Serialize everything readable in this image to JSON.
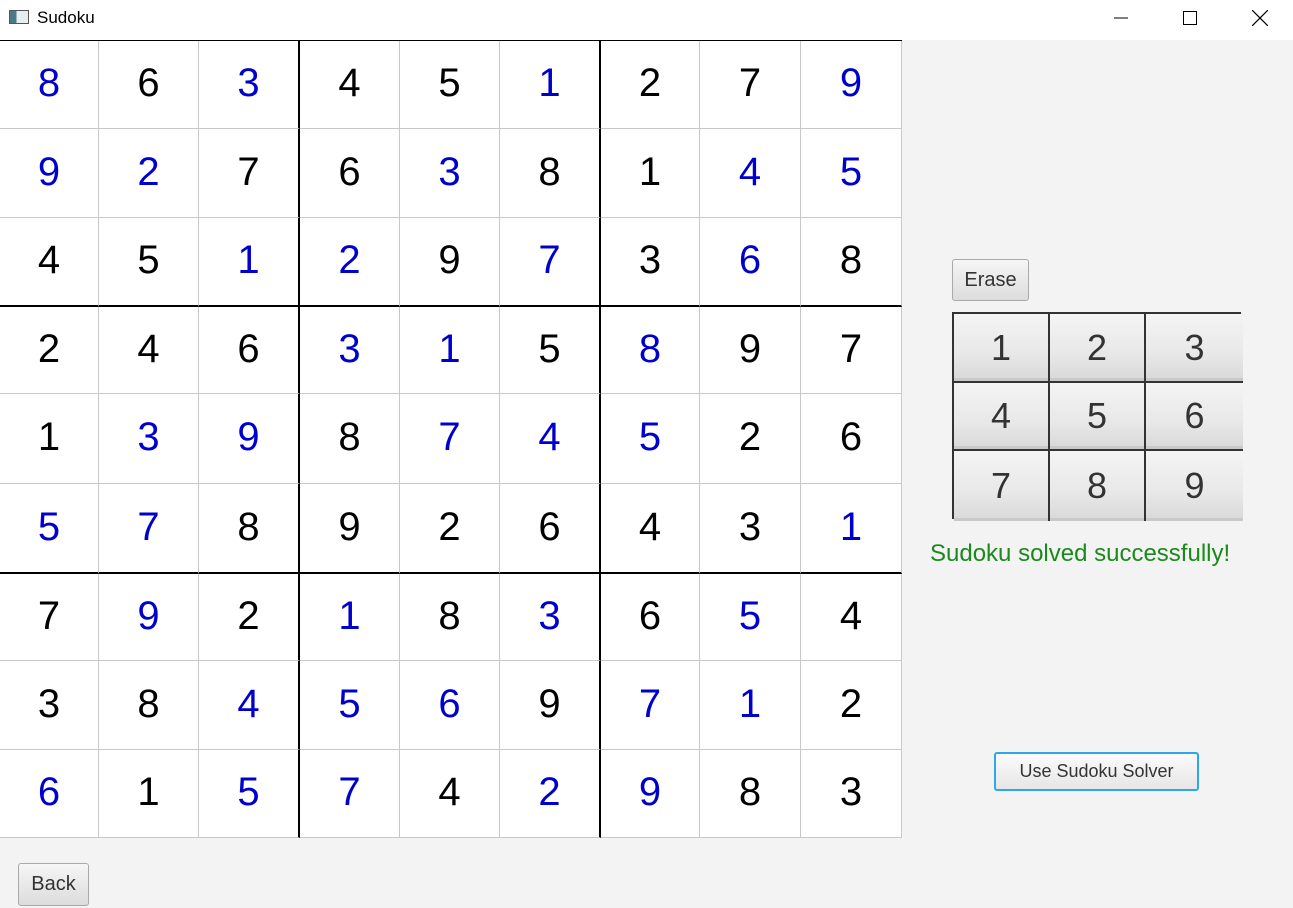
{
  "window": {
    "title": "Sudoku",
    "icon": "app-icon",
    "controls": [
      "minimize-icon",
      "maximize-icon",
      "close-icon"
    ]
  },
  "colors": {
    "given_digit": "#000000",
    "solved_digit": "#0000cc",
    "status_success": "#1a8a1a",
    "focused_button_border": "#2ea7e8"
  },
  "board": {
    "rows": [
      [
        {
          "v": "8",
          "t": "solved"
        },
        {
          "v": "6",
          "t": "given"
        },
        {
          "v": "3",
          "t": "solved"
        },
        {
          "v": "4",
          "t": "given"
        },
        {
          "v": "5",
          "t": "given"
        },
        {
          "v": "1",
          "t": "solved"
        },
        {
          "v": "2",
          "t": "given"
        },
        {
          "v": "7",
          "t": "given"
        },
        {
          "v": "9",
          "t": "solved"
        }
      ],
      [
        {
          "v": "9",
          "t": "solved"
        },
        {
          "v": "2",
          "t": "solved"
        },
        {
          "v": "7",
          "t": "given"
        },
        {
          "v": "6",
          "t": "given"
        },
        {
          "v": "3",
          "t": "solved"
        },
        {
          "v": "8",
          "t": "given"
        },
        {
          "v": "1",
          "t": "given"
        },
        {
          "v": "4",
          "t": "solved"
        },
        {
          "v": "5",
          "t": "solved"
        }
      ],
      [
        {
          "v": "4",
          "t": "given"
        },
        {
          "v": "5",
          "t": "given"
        },
        {
          "v": "1",
          "t": "solved"
        },
        {
          "v": "2",
          "t": "solved"
        },
        {
          "v": "9",
          "t": "given"
        },
        {
          "v": "7",
          "t": "solved"
        },
        {
          "v": "3",
          "t": "given"
        },
        {
          "v": "6",
          "t": "solved"
        },
        {
          "v": "8",
          "t": "given"
        }
      ],
      [
        {
          "v": "2",
          "t": "given"
        },
        {
          "v": "4",
          "t": "given"
        },
        {
          "v": "6",
          "t": "given"
        },
        {
          "v": "3",
          "t": "solved"
        },
        {
          "v": "1",
          "t": "solved"
        },
        {
          "v": "5",
          "t": "given"
        },
        {
          "v": "8",
          "t": "solved"
        },
        {
          "v": "9",
          "t": "given"
        },
        {
          "v": "7",
          "t": "given"
        }
      ],
      [
        {
          "v": "1",
          "t": "given"
        },
        {
          "v": "3",
          "t": "solved"
        },
        {
          "v": "9",
          "t": "solved"
        },
        {
          "v": "8",
          "t": "given"
        },
        {
          "v": "7",
          "t": "solved"
        },
        {
          "v": "4",
          "t": "solved"
        },
        {
          "v": "5",
          "t": "solved"
        },
        {
          "v": "2",
          "t": "given"
        },
        {
          "v": "6",
          "t": "given"
        }
      ],
      [
        {
          "v": "5",
          "t": "solved"
        },
        {
          "v": "7",
          "t": "solved"
        },
        {
          "v": "8",
          "t": "given"
        },
        {
          "v": "9",
          "t": "given"
        },
        {
          "v": "2",
          "t": "given"
        },
        {
          "v": "6",
          "t": "given"
        },
        {
          "v": "4",
          "t": "given"
        },
        {
          "v": "3",
          "t": "given"
        },
        {
          "v": "1",
          "t": "solved"
        }
      ],
      [
        {
          "v": "7",
          "t": "given"
        },
        {
          "v": "9",
          "t": "solved"
        },
        {
          "v": "2",
          "t": "given"
        },
        {
          "v": "1",
          "t": "solved"
        },
        {
          "v": "8",
          "t": "given"
        },
        {
          "v": "3",
          "t": "solved"
        },
        {
          "v": "6",
          "t": "given"
        },
        {
          "v": "5",
          "t": "solved"
        },
        {
          "v": "4",
          "t": "given"
        }
      ],
      [
        {
          "v": "3",
          "t": "given"
        },
        {
          "v": "8",
          "t": "given"
        },
        {
          "v": "4",
          "t": "solved"
        },
        {
          "v": "5",
          "t": "solved"
        },
        {
          "v": "6",
          "t": "solved"
        },
        {
          "v": "9",
          "t": "given"
        },
        {
          "v": "7",
          "t": "solved"
        },
        {
          "v": "1",
          "t": "solved"
        },
        {
          "v": "2",
          "t": "given"
        }
      ],
      [
        {
          "v": "6",
          "t": "solved"
        },
        {
          "v": "1",
          "t": "given"
        },
        {
          "v": "5",
          "t": "solved"
        },
        {
          "v": "7",
          "t": "solved"
        },
        {
          "v": "4",
          "t": "given"
        },
        {
          "v": "2",
          "t": "solved"
        },
        {
          "v": "9",
          "t": "solved"
        },
        {
          "v": "8",
          "t": "given"
        },
        {
          "v": "3",
          "t": "given"
        }
      ]
    ]
  },
  "controls": {
    "erase_label": "Erase",
    "numpad": [
      "1",
      "2",
      "3",
      "4",
      "5",
      "6",
      "7",
      "8",
      "9"
    ],
    "status_message": "Sudoku solved successfully!",
    "solver_label": "Use Sudoku Solver",
    "back_label": "Back"
  }
}
